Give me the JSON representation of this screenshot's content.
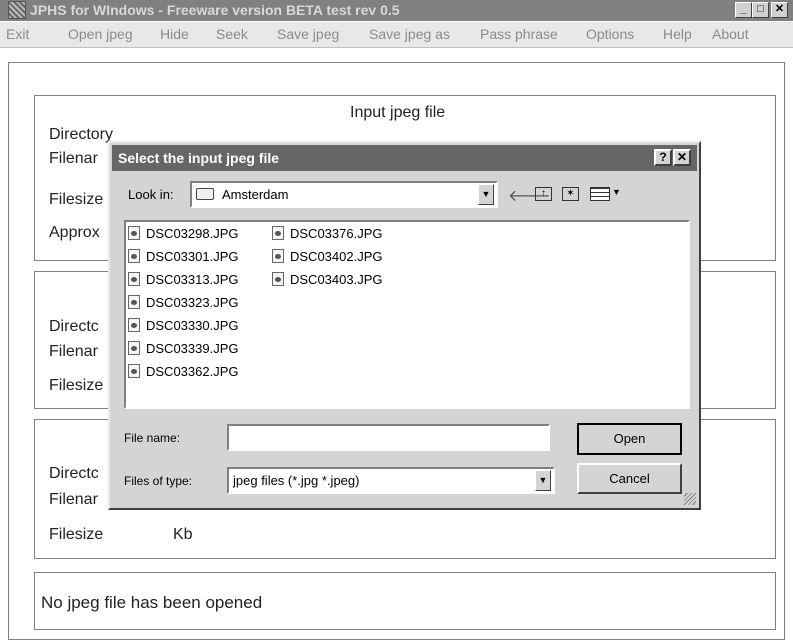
{
  "window": {
    "title": "JPHS for WIndows - Freeware version BETA test rev 0.5"
  },
  "menu": [
    "Exit",
    "Open jpeg",
    "Hide",
    "Seek",
    "Save jpeg",
    "Save jpeg as",
    "Pass phrase",
    "Options",
    "Help",
    "About"
  ],
  "input_group": {
    "heading": "Input jpeg file",
    "directory_label": "Directory",
    "filename_label": "Filenar",
    "filesize_label": "Filesize",
    "approx_label": "Approx"
  },
  "group2": {
    "directory_label": "Directc",
    "filename_label": "Filenar",
    "filesize_label": "Filesize"
  },
  "group3": {
    "directory_label": "Directc",
    "filename_label": "Filenar",
    "filesize_label": "Filesize",
    "filesize_unit": "Kb"
  },
  "status": {
    "text": "No jpeg file has been opened"
  },
  "dialog": {
    "title": "Select the input jpeg file",
    "look_in_label": "Look in:",
    "look_in_value": "Amsterdam",
    "files": [
      "DSC03298.JPG",
      "DSC03301.JPG",
      "DSC03313.JPG",
      "DSC03323.JPG",
      "DSC03330.JPG",
      "DSC03339.JPG",
      "DSC03362.JPG",
      "DSC03376.JPG",
      "DSC03402.JPG",
      "DSC03403.JPG"
    ],
    "filename_label": "File name:",
    "filename_value": "",
    "filetype_label": "Files of type:",
    "filetype_value": "jpeg files (*.jpg *.jpeg)",
    "open_label": "Open",
    "cancel_label": "Cancel"
  }
}
